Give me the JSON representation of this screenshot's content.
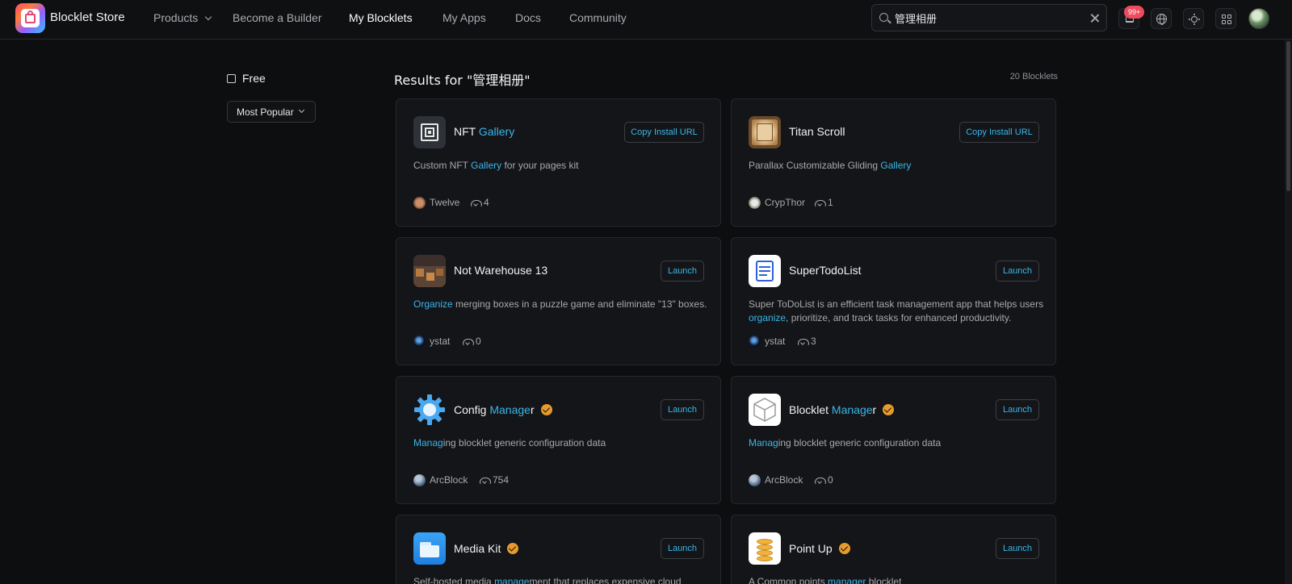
{
  "header": {
    "brand": "Blocklet Store",
    "nav": {
      "products": "Products",
      "become_builder": "Become a Builder",
      "my_blocklets": "My Blocklets",
      "my_apps": "My Apps",
      "docs": "Docs",
      "community": "Community"
    },
    "search_value": "管理相册",
    "notification_badge": "99+"
  },
  "filters": {
    "free_label": "Free",
    "free_checked": false,
    "sort_label": "Most Popular"
  },
  "results": {
    "title": "Results for \"管理相册\"",
    "count": "20 Blocklets"
  },
  "colors": {
    "highlight": "#38b6e9",
    "verified_badge": "#e79b2c",
    "notification_badge": "#ee4b5f"
  },
  "cards": [
    {
      "name_pre": "NFT ",
      "name_hl": "Gallery",
      "name_post": "",
      "button": "Copy Install URL",
      "desc_pre": "Custom NFT ",
      "desc_hl": "Gallery",
      "desc_post": " for your pages kit",
      "author": "Twelve",
      "downloads": "4",
      "icon": "nft-gallery-icon"
    },
    {
      "name_pre": "Titan Scroll",
      "name_hl": "",
      "name_post": "",
      "button": "Copy Install URL",
      "desc_pre": "Parallax Customizable Gliding ",
      "desc_hl": "Gallery",
      "desc_post": "",
      "author": "CrypThor",
      "downloads": "1",
      "icon": "scroll-icon"
    },
    {
      "name_pre": "Not Warehouse 13",
      "name_hl": "",
      "name_post": "",
      "button": "Launch",
      "desc_pre": "",
      "desc_hl": "Organize",
      "desc_post": " merging boxes in a puzzle game and eliminate \"13\" boxes.",
      "author": "ystat",
      "downloads": "0",
      "icon": "warehouse-game-icon"
    },
    {
      "name_pre": "SuperTodoList",
      "name_hl": "",
      "name_post": "",
      "button": "Launch",
      "desc_pre": "Super ToDoList is an efficient task management app that helps users ",
      "desc_hl": "organize",
      "desc_post": ", prioritize, and track tasks for enhanced productivity.",
      "author": "ystat",
      "downloads": "3",
      "icon": "todo-list-icon"
    },
    {
      "name_pre": "Config ",
      "name_hl": "Manage",
      "name_post": "r",
      "button": "Launch",
      "verified": true,
      "desc_pre": "",
      "desc_hl": "Manag",
      "desc_post": "ing blocklet generic configuration data",
      "author": "ArcBlock",
      "downloads": "754",
      "icon": "gear-icon"
    },
    {
      "name_pre": "Blocklet ",
      "name_hl": "Manage",
      "name_post": "r",
      "button": "Launch",
      "verified": true,
      "desc_pre": "",
      "desc_hl": "Manag",
      "desc_post": "ing blocklet generic configuration data",
      "author": "ArcBlock",
      "downloads": "0",
      "icon": "cube-icon"
    },
    {
      "name_pre": "Media Kit",
      "name_hl": "",
      "name_post": "",
      "button": "Launch",
      "verified": true,
      "desc_pre": "Self-hosted media ",
      "desc_hl": "manage",
      "desc_post": "ment that replaces expensive cloud",
      "author": "",
      "downloads": "",
      "icon": "folder-icon"
    },
    {
      "name_pre": "Point Up",
      "name_hl": "",
      "name_post": "",
      "button": "Launch",
      "verified": true,
      "desc_pre": "A Common points ",
      "desc_hl": "manager",
      "desc_post": " blocklet",
      "author": "",
      "downloads": "",
      "icon": "coins-icon"
    }
  ]
}
